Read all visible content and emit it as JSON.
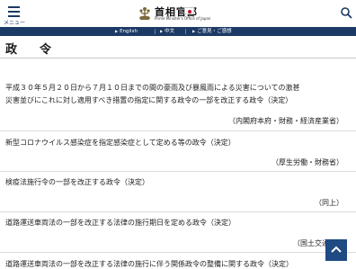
{
  "header": {
    "menu_label": "メニュー",
    "logo_jp": "首相官邸",
    "logo_en": "Prime Minister's Office of Japan"
  },
  "nav": {
    "items": [
      "English",
      "中文",
      "ご意見・ご感想"
    ]
  },
  "page_title": "政　令",
  "items": [
    {
      "title_lines": [
        "平成３０年５月２０日から７月１０日までの間の豪雨及び暴風雨による災害についての激甚",
        "災害並びにこれに対し適用すべき措置の指定に関する政令の一部を改正する政令（決定）"
      ],
      "ministry": "（内閣府本府・財務・経済産業省）"
    },
    {
      "title_lines": [
        "新型コロナウイルス感染症を指定感染症として定める等の政令（決定）"
      ],
      "ministry": "（厚生労働・財務省）"
    },
    {
      "title_lines": [
        "検疫法施行令の一部を改正する政令（決定）"
      ],
      "ministry": "（同上）"
    },
    {
      "title_lines": [
        "道路運送車両法の一部を改正する法律の施行期日を定める政令（決定）"
      ],
      "ministry": "（国土交通省）"
    },
    {
      "title_lines": [
        "道路運送車両法の一部を改正する法律の施行に伴う関係政令の整備に関する政令（決定）"
      ],
      "ministry": ""
    }
  ],
  "colors": {
    "nav_bg": "#1c3a66",
    "to_top_bg": "#1f4a84",
    "flag_red": "#c8102e"
  },
  "icons": {
    "menu": "hamburger-icon",
    "search": "search-icon",
    "to_top": "chevron-up-icon"
  }
}
